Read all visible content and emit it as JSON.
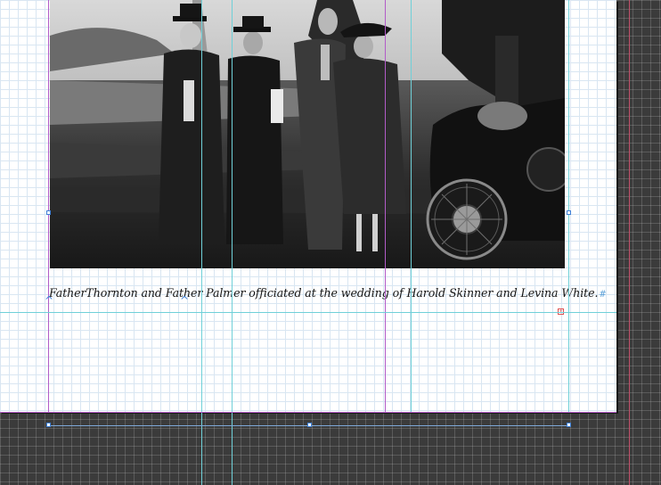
{
  "document": {
    "caption": "FatherThornton and Father Palmer officiated at the wedding of Harold Skinner and Levina White.",
    "paragraph_mark": "#",
    "overset_mark": "+"
  },
  "photo": {
    "subject": "black-and-white photograph of four people in coats and hats standing outdoors beside a vintage car with a spoked wheel"
  },
  "colors": {
    "pasteboard": "#3b3b3b",
    "page": "#ffffff",
    "baseline_grid": "#d9e6f2",
    "ruler_guide": "#6fd0d8",
    "margin_guide": "#b25cc8",
    "frame_edge": "#3d7fd6",
    "text_frame_edge": "#7ea8d8"
  }
}
